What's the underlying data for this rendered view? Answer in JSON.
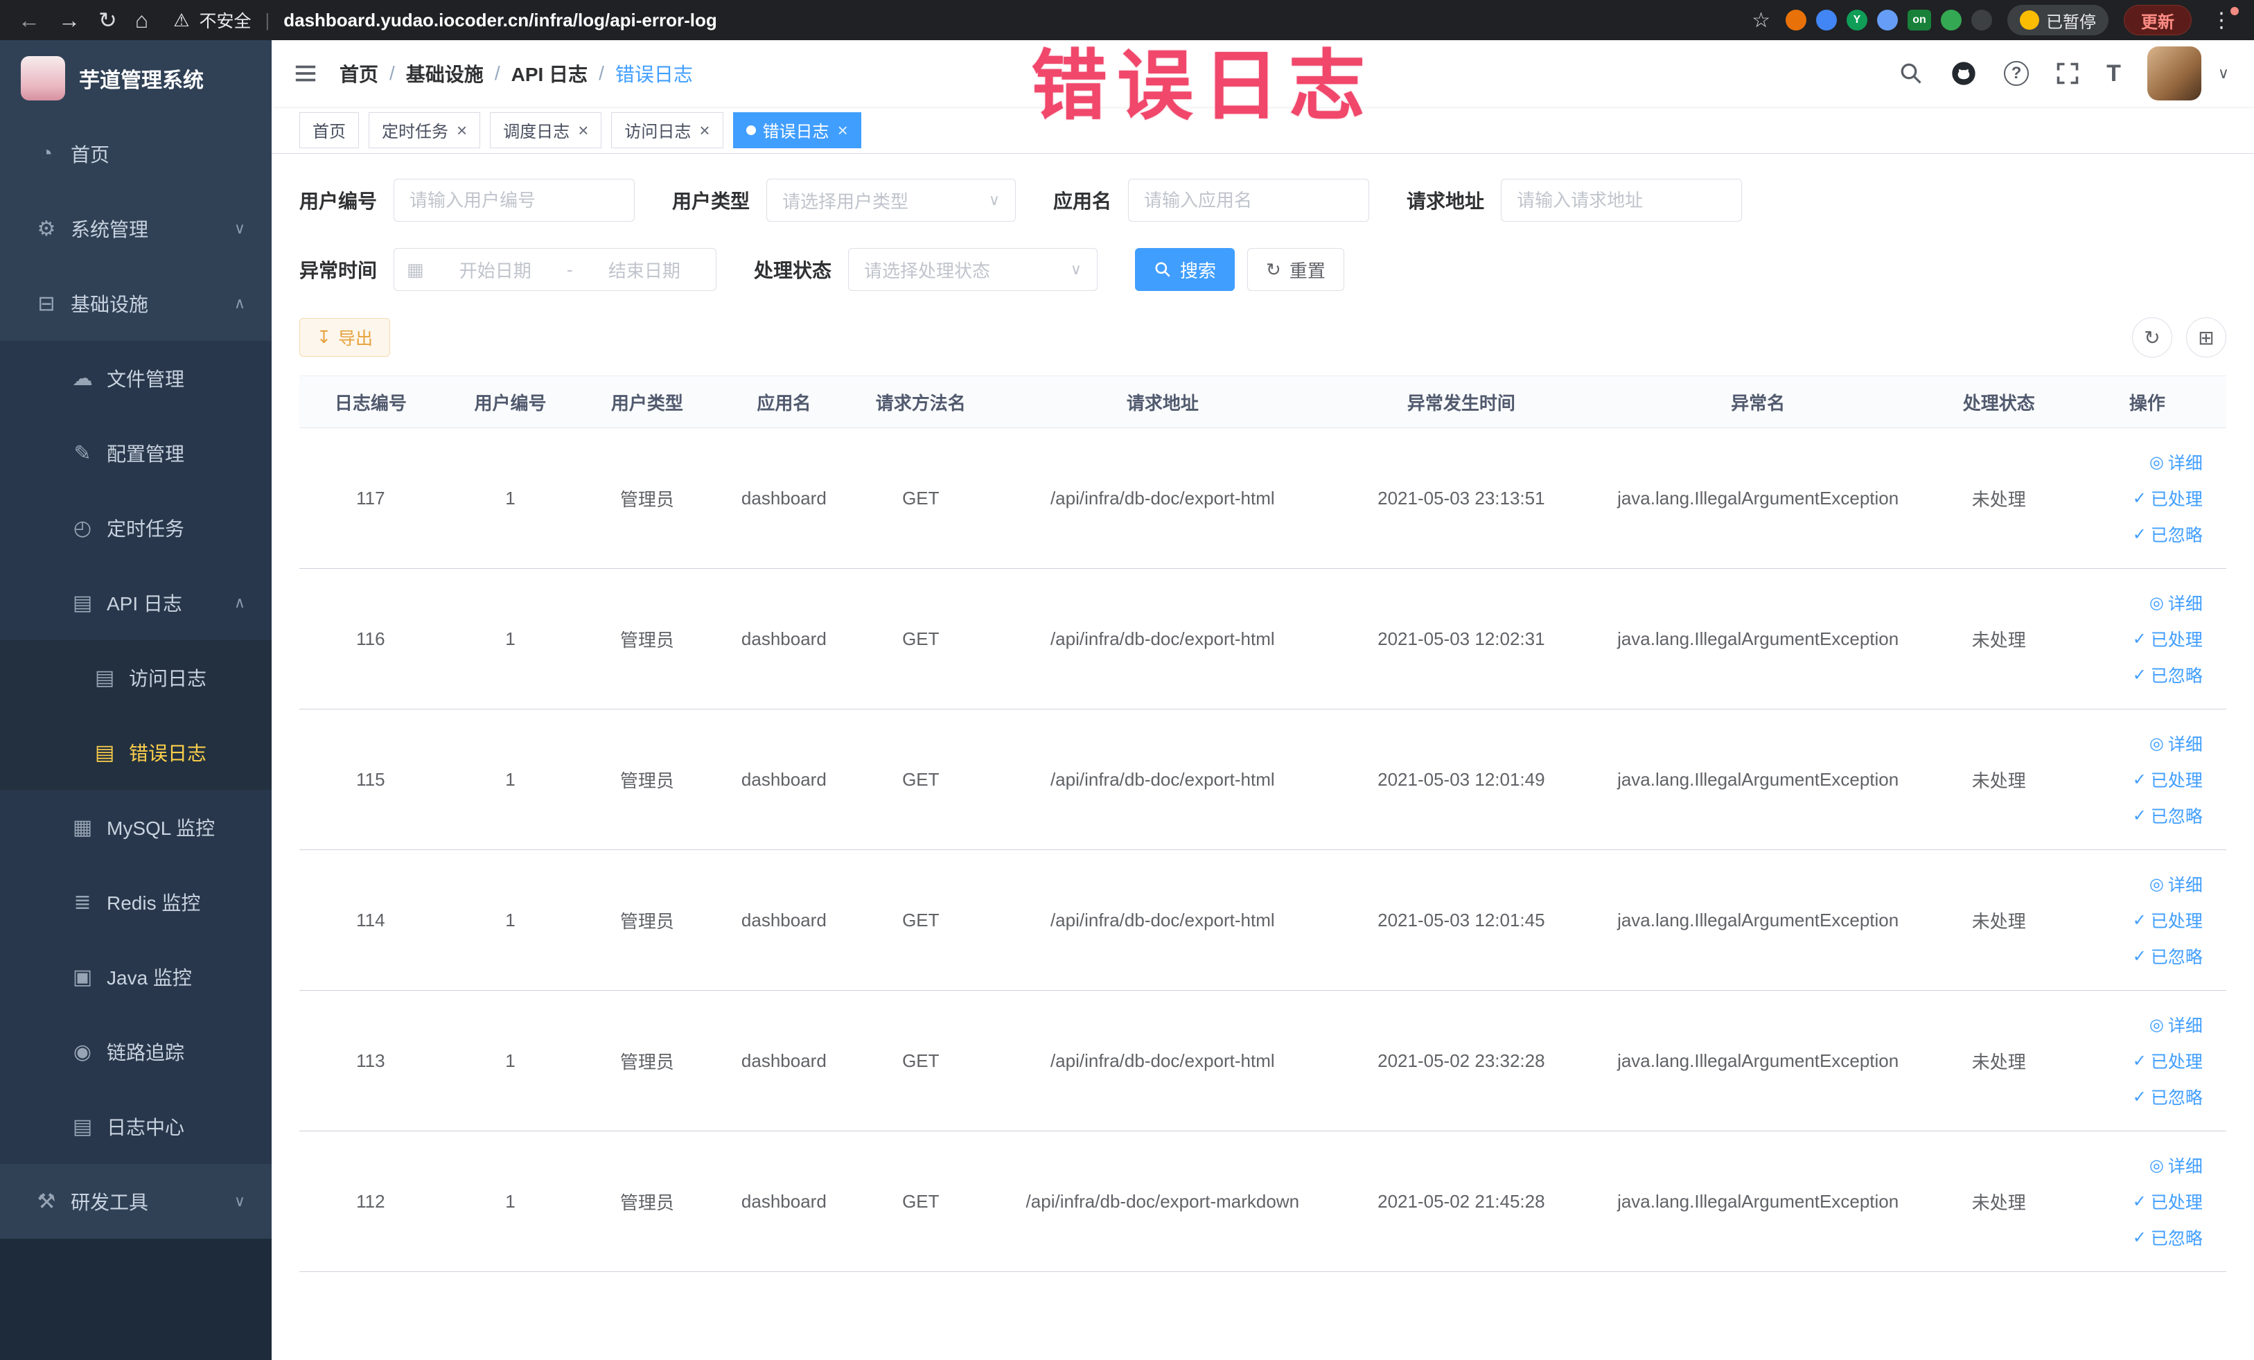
{
  "browser": {
    "back": "←",
    "forward": "→",
    "reload": "↻",
    "home": "⌂",
    "security_label": "不安全",
    "url": "dashboard.yudao.iocoder.cn/infra/log/api-error-log",
    "star": "☆",
    "extensions": [
      {
        "name": "devtools-extension-icon",
        "color": "#e8710a",
        "text": "",
        "shape": "circle"
      },
      {
        "name": "drop-extension-icon",
        "color": "#4285f4",
        "text": "",
        "shape": "circle"
      },
      {
        "name": "vue-extension-icon",
        "color": "#0f9d58",
        "text": "Y",
        "shape": "circle"
      },
      {
        "name": "grid-extension-icon",
        "color": "#669df6",
        "text": "",
        "shape": "circle"
      },
      {
        "name": "on-badge-extension-icon",
        "color": "#188038",
        "text": "on",
        "shape": "badge"
      },
      {
        "name": "leaf-extension-icon",
        "color": "#34a853",
        "text": "",
        "shape": "circle"
      },
      {
        "name": "pin-extension-icon",
        "color": "#3c4043",
        "text": "",
        "shape": "circle"
      }
    ],
    "paused_badge": "已暂停",
    "update_button": "更新",
    "menu_dots": "⋮"
  },
  "annotation": {
    "text": "错误日志"
  },
  "icons": {
    "chevron_down": "∨",
    "chevron_up": "∧",
    "close": "×",
    "eye": "◎",
    "check": "✓",
    "refresh": "↻",
    "download": "↧",
    "calendar": "▦",
    "columns": "⊞",
    "caret": "∨",
    "warning": "⚠"
  },
  "sidebar": {
    "title": "芋道管理系统",
    "menu": [
      {
        "key": "home",
        "label": "首页",
        "icon": "dashboard-icon",
        "glyph": "◔",
        "level": 1
      },
      {
        "key": "system",
        "label": "系统管理",
        "icon": "gear-icon",
        "glyph": "⚙",
        "level": 1,
        "chevron": "down"
      },
      {
        "key": "infra",
        "label": "基础设施",
        "icon": "monitor-icon",
        "glyph": "⊟",
        "level": 1,
        "chevron": "up"
      },
      {
        "key": "file",
        "label": "文件管理",
        "icon": "cloud-icon",
        "glyph": "☁",
        "level": 2
      },
      {
        "key": "config",
        "label": "配置管理",
        "icon": "edit-icon",
        "glyph": "✎",
        "level": 2
      },
      {
        "key": "job",
        "label": "定时任务",
        "icon": "clock-icon",
        "glyph": "◴",
        "level": 2
      },
      {
        "key": "api-log",
        "label": "API 日志",
        "icon": "document-icon",
        "glyph": "▤",
        "level": 2,
        "chevron": "up"
      },
      {
        "key": "access-log",
        "label": "访问日志",
        "icon": "document-icon",
        "glyph": "▤",
        "level": 3
      },
      {
        "key": "error-log",
        "label": "错误日志",
        "icon": "document-icon",
        "glyph": "▤",
        "level": 3,
        "active": true
      },
      {
        "key": "mysql",
        "label": "MySQL 监控",
        "icon": "database-icon",
        "glyph": "▦",
        "level": 2
      },
      {
        "key": "redis",
        "label": "Redis 监控",
        "icon": "layers-icon",
        "glyph": "≣",
        "level": 2
      },
      {
        "key": "java",
        "label": "Java 监控",
        "icon": "screen-icon",
        "glyph": "▣",
        "level": 2
      },
      {
        "key": "tracer",
        "label": "链路追踪",
        "icon": "eye-icon",
        "glyph": "◉",
        "level": 2
      },
      {
        "key": "log-center",
        "label": "日志中心",
        "icon": "document-icon",
        "glyph": "▤",
        "level": 2
      },
      {
        "key": "dev-tools",
        "label": "研发工具",
        "icon": "tools-icon",
        "glyph": "⚒",
        "level": 1,
        "chevron": "down"
      }
    ]
  },
  "breadcrumb": {
    "separator": "/",
    "items": [
      "首页",
      "基础设施",
      "API 日志",
      "错误日志"
    ]
  },
  "tags": [
    {
      "key": "home",
      "label": "首页",
      "closable": false,
      "active": false
    },
    {
      "key": "job",
      "label": "定时任务",
      "closable": true,
      "active": false
    },
    {
      "key": "job-log",
      "label": "调度日志",
      "closable": true,
      "active": false
    },
    {
      "key": "access-log",
      "label": "访问日志",
      "closable": true,
      "active": false
    },
    {
      "key": "error-log",
      "label": "错误日志",
      "closable": true,
      "active": true
    }
  ],
  "filters": {
    "user_id": {
      "label": "用户编号",
      "placeholder": "请输入用户编号"
    },
    "user_type": {
      "label": "用户类型",
      "placeholder": "请选择用户类型"
    },
    "app_name": {
      "label": "应用名",
      "placeholder": "请输入应用名"
    },
    "request_url": {
      "label": "请求地址",
      "placeholder": "请输入请求地址"
    },
    "exception_time": {
      "label": "异常时间",
      "start_placeholder": "开始日期",
      "separator": "-",
      "end_placeholder": "结束日期"
    },
    "process_status": {
      "label": "处理状态",
      "placeholder": "请选择处理状态"
    },
    "search_button": "搜索",
    "reset_button": "重置"
  },
  "toolbar": {
    "export_button": "导出"
  },
  "table": {
    "columns": [
      "日志编号",
      "用户编号",
      "用户类型",
      "应用名",
      "请求方法名",
      "请求地址",
      "异常发生时间",
      "异常名",
      "处理状态",
      "操作"
    ],
    "row_keys": [
      "id",
      "user_id",
      "user_type",
      "app",
      "method",
      "url",
      "time",
      "exception",
      "status"
    ],
    "actions": [
      {
        "key": "detail",
        "label": "详细",
        "icon": "eye-icon",
        "glyph": "◎"
      },
      {
        "key": "done",
        "label": "已处理",
        "icon": "check-icon",
        "glyph": "✓"
      },
      {
        "key": "ignored",
        "label": "已忽略",
        "icon": "check-icon",
        "glyph": "✓"
      }
    ],
    "rows": [
      {
        "id": "117",
        "user_id": "1",
        "user_type": "管理员",
        "app": "dashboard",
        "method": "GET",
        "url": "/api/infra/db-doc/export-html",
        "time": "2021-05-03 23:13:51",
        "exception": "java.lang.IllegalArgumentException",
        "status": "未处理"
      },
      {
        "id": "116",
        "user_id": "1",
        "user_type": "管理员",
        "app": "dashboard",
        "method": "GET",
        "url": "/api/infra/db-doc/export-html",
        "time": "2021-05-03 12:02:31",
        "exception": "java.lang.IllegalArgumentException",
        "status": "未处理"
      },
      {
        "id": "115",
        "user_id": "1",
        "user_type": "管理员",
        "app": "dashboard",
        "method": "GET",
        "url": "/api/infra/db-doc/export-html",
        "time": "2021-05-03 12:01:49",
        "exception": "java.lang.IllegalArgumentException",
        "status": "未处理"
      },
      {
        "id": "114",
        "user_id": "1",
        "user_type": "管理员",
        "app": "dashboard",
        "method": "GET",
        "url": "/api/infra/db-doc/export-html",
        "time": "2021-05-03 12:01:45",
        "exception": "java.lang.IllegalArgumentException",
        "status": "未处理"
      },
      {
        "id": "113",
        "user_id": "1",
        "user_type": "管理员",
        "app": "dashboard",
        "method": "GET",
        "url": "/api/infra/db-doc/export-html",
        "time": "2021-05-02 23:32:28",
        "exception": "java.lang.IllegalArgumentException",
        "status": "未处理"
      },
      {
        "id": "112",
        "user_id": "1",
        "user_type": "管理员",
        "app": "dashboard",
        "method": "GET",
        "url": "/api/infra/db-doc/export-markdown",
        "time": "2021-05-02 21:45:28",
        "exception": "java.lang.IllegalArgumentException",
        "status": "未处理"
      }
    ]
  }
}
